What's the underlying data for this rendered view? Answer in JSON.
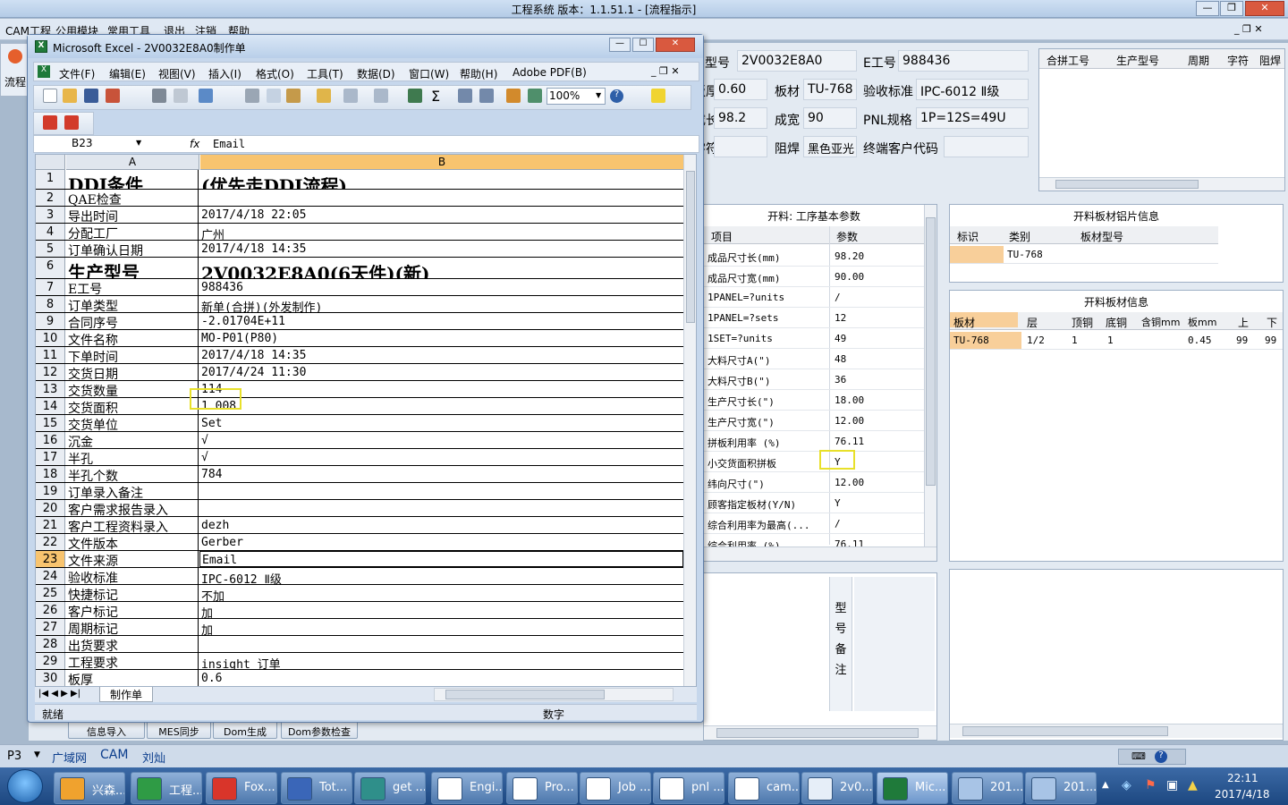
{
  "app": {
    "title": "工程系统   版本：1.1.51.1 - [流程指示]",
    "menu": [
      "CAM工程",
      "公用模块",
      "常用工具",
      "退出",
      "注销",
      "帮助"
    ],
    "left_tab": "流程"
  },
  "form": {
    "model_label": "生产型号",
    "model_value": "2V0032E8A0",
    "e_label": "E工号",
    "e_value": "988436",
    "thick_label": "板厚",
    "thick_value": "0.60",
    "board_label": "板材",
    "board_value": "TU-768",
    "accept_label": "验收标准",
    "accept_value": "IPC-6012 Ⅱ级",
    "len_label": "成长",
    "len_value": "98.2",
    "wid_label": "成宽",
    "wid_value": "90",
    "pnl_label": "PNL规格",
    "pnl_value": "1P=12S=49U",
    "char_label": "字符",
    "mask_label": "阻焊",
    "mask_value": "黑色亚光",
    "cust_label": "终端客户代码",
    "cust_value": ""
  },
  "merge_table": {
    "headers": [
      "合拼工号",
      "生产型号",
      "周期",
      "字符",
      "阻焊"
    ]
  },
  "params": {
    "title": "开料: 工序基本参数",
    "headers": [
      "项目",
      "参数"
    ],
    "rows": [
      [
        "成品尺寸长(mm)",
        "98.20"
      ],
      [
        "成品尺寸宽(mm)",
        "90.00"
      ],
      [
        "1PANEL=?units",
        "/"
      ],
      [
        "1PANEL=?sets",
        "12"
      ],
      [
        "1SET=?units",
        "49"
      ],
      [
        "大料尺寸A(\")",
        "48"
      ],
      [
        "大料尺寸B(\")",
        "36"
      ],
      [
        "生产尺寸长(\")",
        "18.00"
      ],
      [
        "生产尺寸宽(\")",
        "12.00"
      ],
      [
        "拼板利用率 (%)",
        "76.11"
      ],
      [
        "小交货面积拼板",
        "Y"
      ],
      [
        "纬向尺寸(\")",
        "12.00"
      ],
      [
        "顾客指定板材(Y/N)",
        "Y"
      ],
      [
        "综合利用率为最高(...",
        "/"
      ],
      [
        "综合利用率 (%)",
        "76.11"
      ]
    ]
  },
  "photo_info": {
    "title": "开料板材铝片信息",
    "headers": [
      "标识",
      "类别",
      "板材型号"
    ],
    "row": [
      "",
      "TU-768",
      ""
    ]
  },
  "board_info": {
    "title": "开料板材信息",
    "headers": [
      "板材",
      "层",
      "顶铜",
      "底铜",
      "含铜mm",
      "板mm",
      "上",
      "下"
    ],
    "row": [
      "TU-768",
      "1/2",
      "1",
      "1",
      "",
      "0.45",
      "99",
      "99"
    ]
  },
  "note_label": [
    "型",
    "号",
    "备",
    "注"
  ],
  "bottom_buttons": [
    "信息导入",
    "MES同步",
    "Dom生成",
    "Dom参数检查"
  ],
  "status": {
    "p": "P3",
    "items": [
      "广域网",
      "CAM",
      "刘灿"
    ]
  },
  "excel": {
    "title": "Microsoft Excel - 2V0032E8A0制作单",
    "menu": [
      "文件(F)",
      "编辑(E)",
      "视图(V)",
      "插入(I)",
      "格式(O)",
      "工具(T)",
      "数据(D)",
      "窗口(W)",
      "帮助(H)",
      "Adobe PDF(B)"
    ],
    "zoom": "100%",
    "cell_ref": "B23",
    "formula": "Email",
    "col_a": "A",
    "col_b": "B",
    "rows": [
      [
        "1",
        "DDI条件",
        "(优先走DDI流程)"
      ],
      [
        "2",
        "QAE检查",
        ""
      ],
      [
        "3",
        "导出时间",
        "2017/4/18 22:05"
      ],
      [
        "4",
        "分配工厂",
        "广州"
      ],
      [
        "5",
        "订单确认日期",
        "2017/4/18 14:35"
      ],
      [
        "6",
        "生产型号",
        "2V0032E8A0(6天件)(新)"
      ],
      [
        "7",
        "E工号",
        "988436"
      ],
      [
        "8",
        "订单类型",
        "新单(合拼)(外发制作)"
      ],
      [
        "9",
        "合同序号",
        "-2.01704E+11"
      ],
      [
        "10",
        "文件名称",
        "MO-P01(P80)"
      ],
      [
        "11",
        "下单时间",
        "2017/4/18 14:35"
      ],
      [
        "12",
        "交货日期",
        "2017/4/24 11:30"
      ],
      [
        "13",
        "交货数量",
        "114"
      ],
      [
        "14",
        "交货面积",
        "1.008"
      ],
      [
        "15",
        "交货单位",
        "Set"
      ],
      [
        "16",
        "沉金",
        "√"
      ],
      [
        "17",
        "半孔",
        "√"
      ],
      [
        "18",
        "半孔个数",
        "784"
      ],
      [
        "19",
        "订单录入备注",
        ""
      ],
      [
        "20",
        "客户需求报告录入",
        ""
      ],
      [
        "21",
        "客户工程资料录入",
        "dezh"
      ],
      [
        "22",
        "文件版本",
        "Gerber"
      ],
      [
        "23",
        "文件来源",
        "Email"
      ],
      [
        "24",
        "验收标准",
        "IPC-6012 Ⅱ级"
      ],
      [
        "25",
        "快捷标记",
        "不加"
      ],
      [
        "26",
        "客户标记",
        "加"
      ],
      [
        "27",
        "周期标记",
        "加"
      ],
      [
        "28",
        "出货要求",
        ""
      ],
      [
        "29",
        "工程要求",
        "insight 订单"
      ],
      [
        "30",
        "板厚",
        "0.6"
      ]
    ],
    "sheet_tab": "制作单",
    "status_left": "就绪",
    "status_right": "数字"
  },
  "taskbar": {
    "items": [
      "兴森...",
      "工程...",
      "Fox...",
      "Tot...",
      "get ...",
      "Engi...",
      "Pro...",
      "Job ...",
      "pnl ...",
      "cam...",
      "2v0...",
      "Mic...",
      "201...",
      "201..."
    ],
    "time": "22:11",
    "date": "2017/4/18"
  }
}
